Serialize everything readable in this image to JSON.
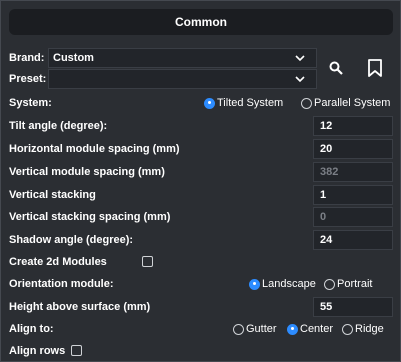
{
  "header": {
    "title": "Common"
  },
  "brand": {
    "label": "Brand:",
    "value": "Custom"
  },
  "preset": {
    "label": "Preset:",
    "value": ""
  },
  "system": {
    "label": "System:",
    "options": [
      "Tilted System",
      "Parallel System"
    ],
    "selected": "Tilted System"
  },
  "fields": [
    {
      "label": "Tilt angle (degree):",
      "value": "12",
      "disabled": false
    },
    {
      "label": "Horizontal module spacing (mm)",
      "value": "20",
      "disabled": false
    },
    {
      "label": "Vertical module spacing (mm)",
      "value": "382",
      "disabled": true
    },
    {
      "label": "Vertical stacking",
      "value": "1",
      "disabled": false
    },
    {
      "label": "Vertical stacking spacing (mm)",
      "value": "0",
      "disabled": true
    },
    {
      "label": "Shadow angle (degree):",
      "value": "24",
      "disabled": false
    }
  ],
  "create2d": {
    "label": "Create 2d Modules",
    "checked": false
  },
  "orientation": {
    "label": "Orientation module:",
    "options": [
      "Landscape",
      "Portrait"
    ],
    "selected": "Landscape"
  },
  "height": {
    "label": "Height above surface (mm)",
    "value": "55"
  },
  "align": {
    "label": "Align to:",
    "options": [
      "Gutter",
      "Center",
      "Ridge"
    ],
    "selected": "Center"
  },
  "alignRows": {
    "label": "Align rows",
    "checked": false
  },
  "icons": {
    "search": "search-icon",
    "bookmark": "bookmark-icon"
  },
  "colors": {
    "accent": "#2d8cff",
    "background": "#2b2e33",
    "field": "#22252a",
    "header": "#1b1d21"
  }
}
